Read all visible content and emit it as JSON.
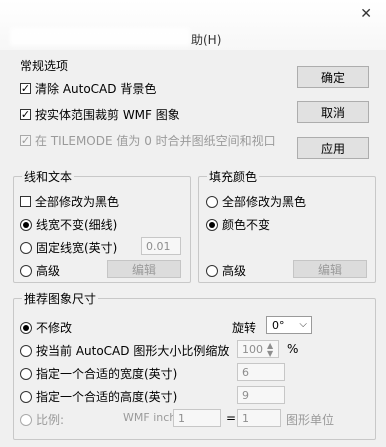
{
  "window": {
    "menu_fragment": "助(H)"
  },
  "buttons": {
    "ok": "确定",
    "cancel": "取消",
    "apply": "应用",
    "edit": "编辑"
  },
  "general": {
    "title": "常规选项",
    "remove_bg": "清除 AutoCAD 背景色",
    "clip_wmf": "按实体范围裁剪 WMF 图象",
    "tilemode": "在 TILEMODE 值为 0 时合并图纸空间和视口"
  },
  "line_text": {
    "title": "线和文本",
    "all_black": "全部修改为黑色",
    "keep_width": "线宽不变(细线)",
    "fixed_width": "固定线宽(英寸)",
    "fixed_width_value": "0.01",
    "advanced": "高级"
  },
  "fill_color": {
    "title": "填充颜色",
    "all_black": "全部修改为黑色",
    "keep_color": "颜色不变",
    "advanced": "高级"
  },
  "size": {
    "title": "推荐图象尺寸",
    "no_change": "不修改",
    "rotate_label": "旋转",
    "rotate_value": "0°",
    "scale_current": "按当前 AutoCAD 图形大小比例缩放",
    "scale_value": "100",
    "percent": "%",
    "fit_width": "指定一个合适的宽度(英寸)",
    "width_value": "6",
    "fit_height": "指定一个合适的高度(英寸)",
    "height_value": "9",
    "ratio": "比例:",
    "wmf_inch": "WMF inch",
    "wmf_value": "1",
    "equals": "=",
    "units_value": "1",
    "units_label": "图形单位"
  }
}
